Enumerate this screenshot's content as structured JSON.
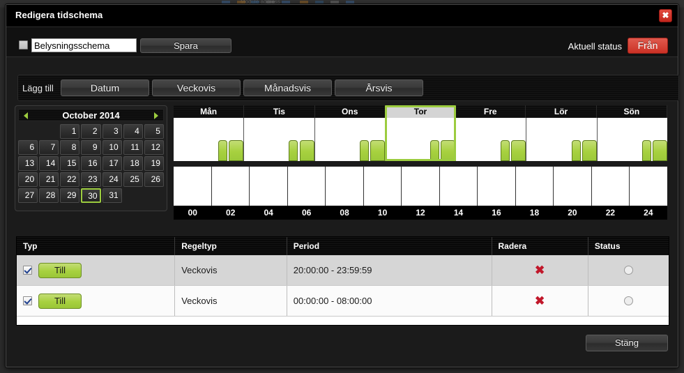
{
  "background": {
    "strip_texts": [
      "Module address"
    ],
    "chips": [
      "#3b6ea5",
      "#b0721f",
      "#2f5f8f",
      "#7b7b7b"
    ]
  },
  "dialog": {
    "title": "Redigera tidschema",
    "close_icon": "close-x-icon"
  },
  "name_row": {
    "enabled_checkbox_checked": false,
    "schedule_name": "Belysningsschema",
    "schedule_name_placeholder": "Belysningsschema",
    "save_label": "Spara",
    "status_label": "Aktuell status",
    "status_value": "Från",
    "status_color": "#cb3125"
  },
  "add_row": {
    "label": "Lägg till",
    "tabs": [
      {
        "label": "Datum"
      },
      {
        "label": "Veckovis"
      },
      {
        "label": "Månadsvis"
      },
      {
        "label": "Årsvis"
      }
    ]
  },
  "calendar": {
    "month_title": "October 2014",
    "prev_icon": "chevron-left-icon",
    "next_icon": "chevron-right-icon",
    "leading_blanks": 2,
    "days": [
      1,
      2,
      3,
      4,
      5,
      6,
      7,
      8,
      9,
      10,
      11,
      12,
      13,
      14,
      15,
      16,
      17,
      18,
      19,
      20,
      21,
      22,
      23,
      24,
      25,
      26,
      27,
      28,
      29,
      30,
      31
    ],
    "selected_day": 30,
    "accent_color": "#9ccc3f"
  },
  "week_chart": {
    "days": [
      "Mån",
      "Tis",
      "Ons",
      "Tor",
      "Fre",
      "Lör",
      "Sön"
    ],
    "selected_day": "Tor",
    "time_ticks": [
      "00",
      "02",
      "04",
      "06",
      "08",
      "10",
      "12",
      "14",
      "16",
      "18",
      "20",
      "22",
      "24"
    ],
    "bar_color": "#a7d13f",
    "bars": [
      {
        "day": "Mån",
        "left_pct": 64,
        "width_pct": 13
      },
      {
        "day": "Mån",
        "left_pct": 79,
        "width_pct": 21
      },
      {
        "day": "Tis",
        "left_pct": 64,
        "width_pct": 13
      },
      {
        "day": "Tis",
        "left_pct": 79,
        "width_pct": 21
      },
      {
        "day": "Ons",
        "left_pct": 64,
        "width_pct": 13
      },
      {
        "day": "Ons",
        "left_pct": 79,
        "width_pct": 21
      },
      {
        "day": "Tor",
        "left_pct": 64,
        "width_pct": 13
      },
      {
        "day": "Tor",
        "left_pct": 79,
        "width_pct": 21
      },
      {
        "day": "Fre",
        "left_pct": 64,
        "width_pct": 13
      },
      {
        "day": "Fre",
        "left_pct": 79,
        "width_pct": 21
      },
      {
        "day": "Lör",
        "left_pct": 64,
        "width_pct": 13
      },
      {
        "day": "Lör",
        "left_pct": 79,
        "width_pct": 21
      },
      {
        "day": "Sön",
        "left_pct": 64,
        "width_pct": 13
      },
      {
        "day": "Sön",
        "left_pct": 79,
        "width_pct": 21
      }
    ]
  },
  "rules_table": {
    "columns": [
      "Typ",
      "Regeltyp",
      "Period",
      "Radera",
      "Status"
    ],
    "rows": [
      {
        "enabled": true,
        "type_label": "Till",
        "rule_type": "Veckovis",
        "period": "20:00:00 - 23:59:59",
        "delete_icon": "delete-x-icon",
        "status_icon": "status-circle-icon"
      },
      {
        "enabled": true,
        "type_label": "Till",
        "rule_type": "Veckovis",
        "period": "00:00:00 - 08:00:00",
        "delete_icon": "delete-x-icon",
        "status_icon": "status-circle-icon"
      }
    ]
  },
  "footer": {
    "close_label": "Stäng"
  }
}
